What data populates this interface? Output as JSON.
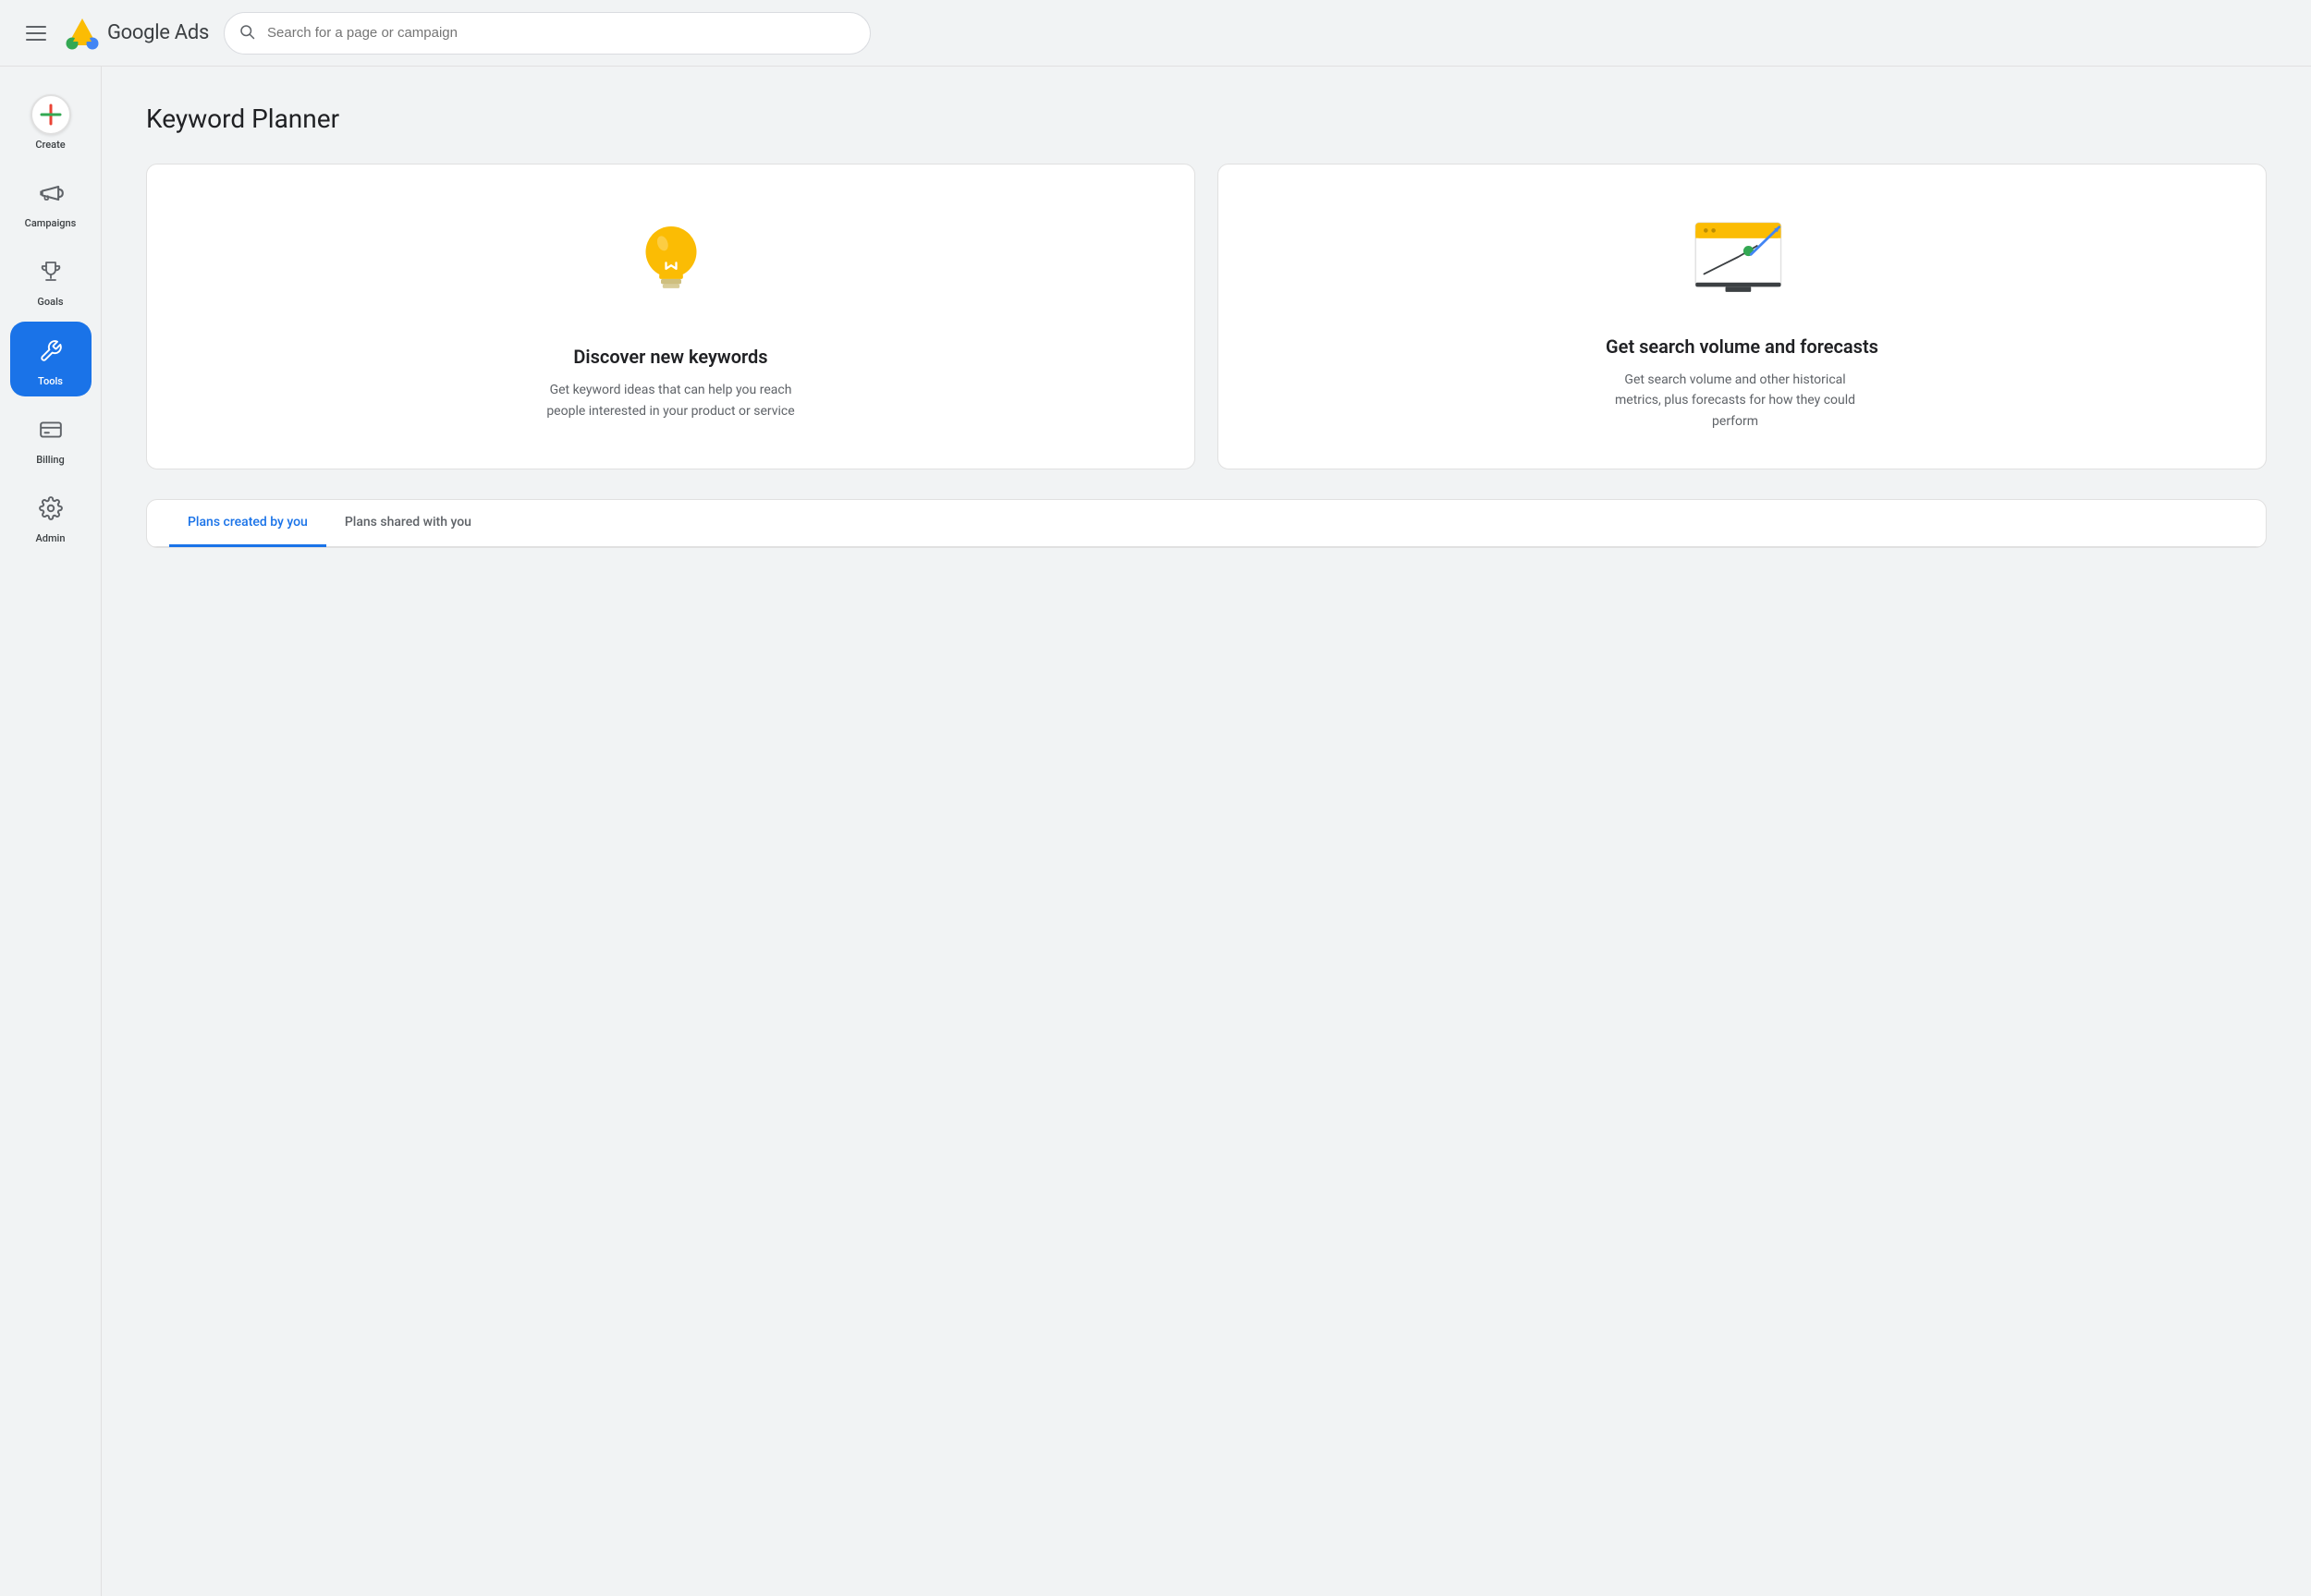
{
  "header": {
    "menu_label": "Main menu",
    "app_title": "Google Ads",
    "search_placeholder": "Search for a page or campaign"
  },
  "sidebar": {
    "items": [
      {
        "id": "create",
        "label": "Create",
        "icon": "plus",
        "active": false,
        "is_create": true
      },
      {
        "id": "campaigns",
        "label": "Campaigns",
        "icon": "megaphone",
        "active": false
      },
      {
        "id": "goals",
        "label": "Goals",
        "icon": "trophy",
        "active": false
      },
      {
        "id": "tools",
        "label": "Tools",
        "icon": "wrench",
        "active": true
      },
      {
        "id": "billing",
        "label": "Billing",
        "icon": "creditcard",
        "active": false
      },
      {
        "id": "admin",
        "label": "Admin",
        "icon": "gear",
        "active": false
      }
    ]
  },
  "main": {
    "page_title": "Keyword Planner",
    "cards": [
      {
        "id": "discover",
        "title": "Discover new keywords",
        "description": "Get keyword ideas that can help you reach people interested in your product or service"
      },
      {
        "id": "forecasts",
        "title": "Get search volume and forecasts",
        "description": "Get search volume and other historical metrics, plus forecasts for how they could perform"
      }
    ],
    "tabs": [
      {
        "id": "created-by-you",
        "label": "Plans created by you",
        "active": true
      },
      {
        "id": "shared-with-you",
        "label": "Plans shared with you",
        "active": false
      }
    ]
  }
}
